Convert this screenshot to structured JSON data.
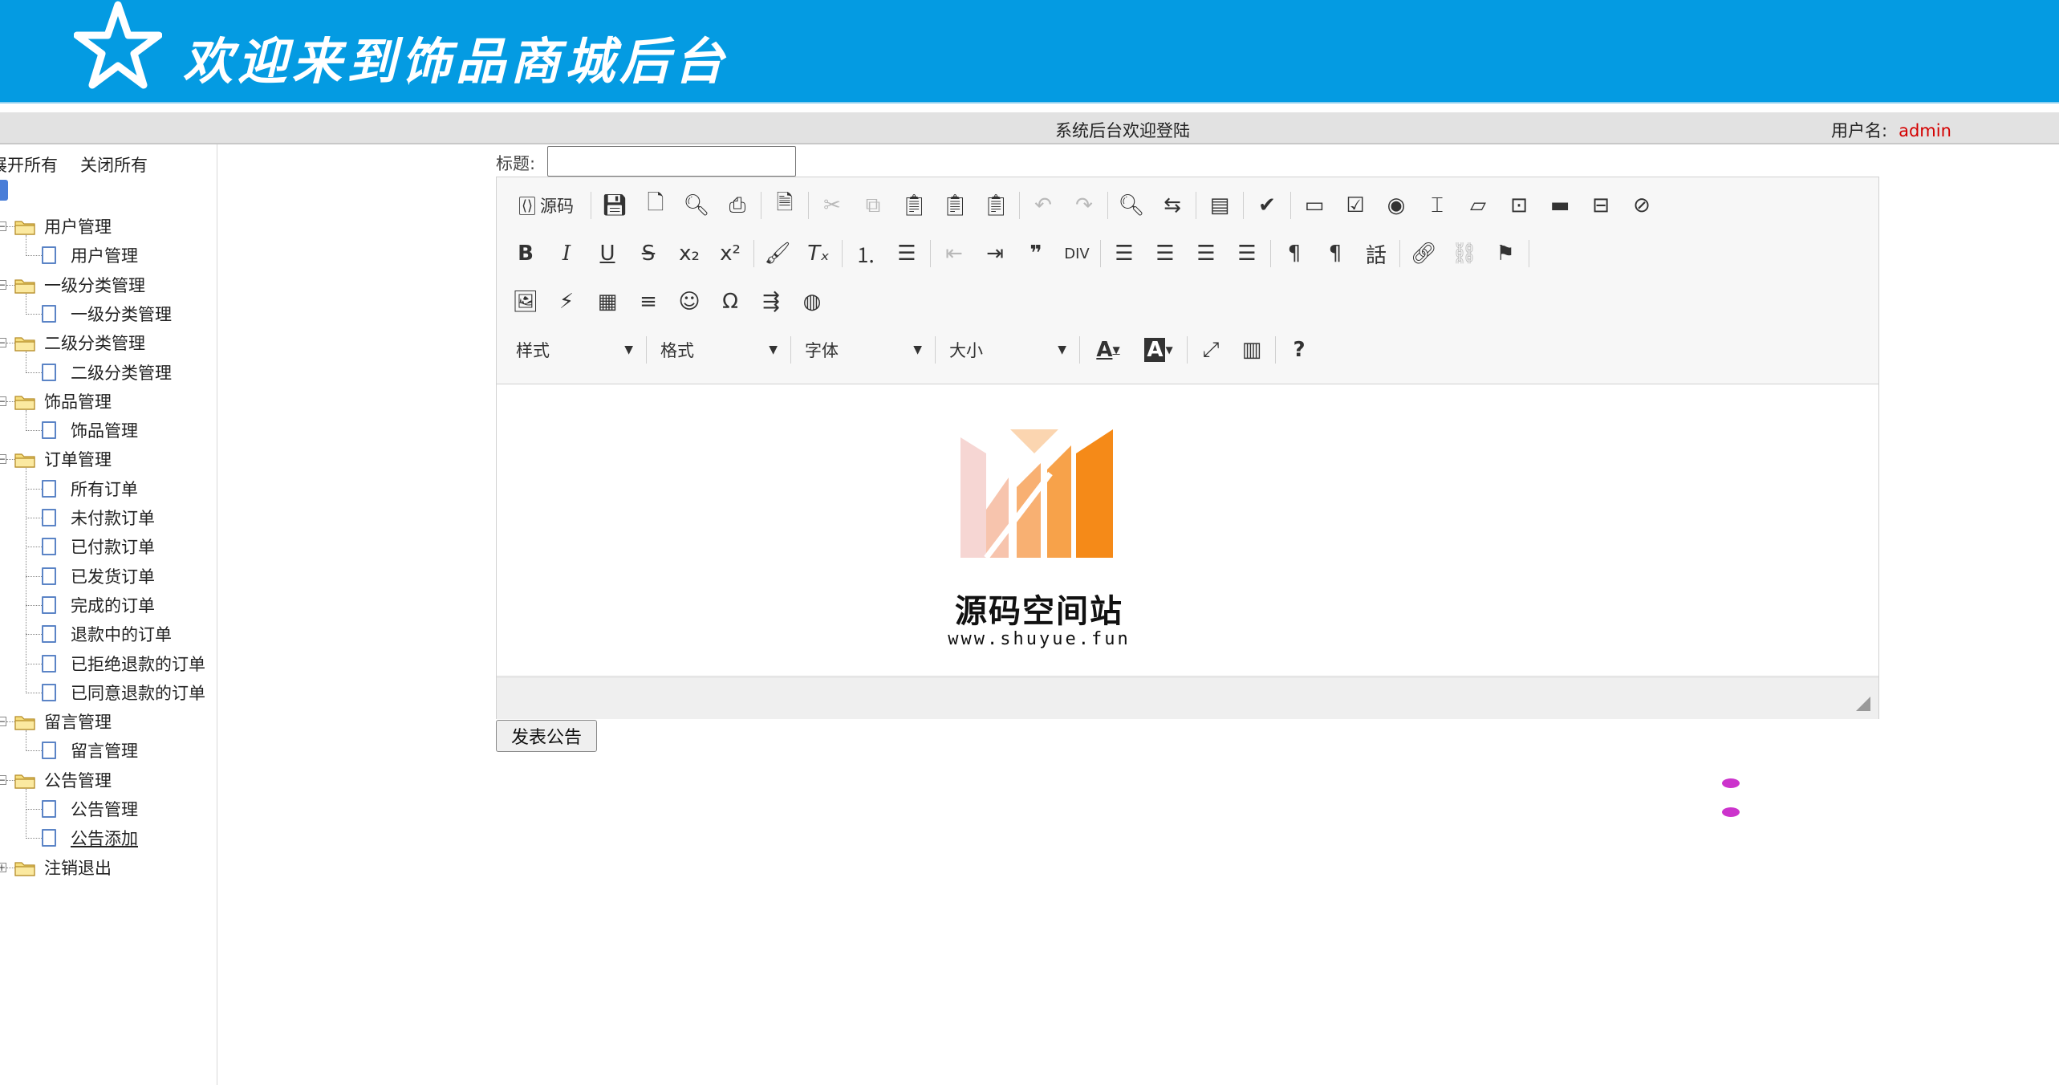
{
  "header": {
    "title": "欢迎来到饰品商城后台"
  },
  "topbar": {
    "welcome": "系统后台欢迎登陆",
    "user_label": "用户名:",
    "username": "admin"
  },
  "sidebar": {
    "expand_all": "展开所有",
    "collapse_all": "关闭所有",
    "groups": [
      {
        "label": "用户管理",
        "items": [
          "用户管理"
        ]
      },
      {
        "label": "一级分类管理",
        "items": [
          "一级分类管理"
        ]
      },
      {
        "label": "二级分类管理",
        "items": [
          "二级分类管理"
        ]
      },
      {
        "label": "饰品管理",
        "items": [
          "饰品管理"
        ]
      },
      {
        "label": "订单管理",
        "items": [
          "所有订单",
          "未付款订单",
          "已付款订单",
          "已发货订单",
          "完成的订单",
          "退款中的订单",
          "已拒绝退款的订单",
          "已同意退款的订单"
        ]
      },
      {
        "label": "留言管理",
        "items": [
          "留言管理"
        ]
      },
      {
        "label": "公告管理",
        "items": [
          "公告管理",
          "公告添加"
        ]
      },
      {
        "label": "注销退出",
        "items": []
      }
    ]
  },
  "form": {
    "title_label": "标题:",
    "title_value": "",
    "publish_button": "发表公告"
  },
  "editor": {
    "source_label": "源码",
    "combos": {
      "style": "样式",
      "format": "格式",
      "font": "字体",
      "size": "大小"
    },
    "content": {
      "logo_text": "源码空间站",
      "logo_url": "www.shuyue.fun"
    }
  },
  "colors": {
    "header_bg": "#049be2",
    "username": "#d40000",
    "logo_orange": "#f7941d"
  }
}
